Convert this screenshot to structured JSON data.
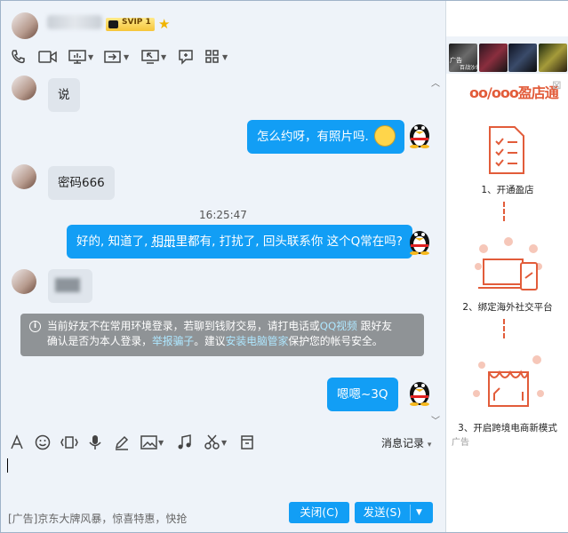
{
  "header": {
    "vip_badge": "SVIP 1",
    "window_controls": [
      "≡",
      "—",
      "☐",
      "✕"
    ]
  },
  "toolbar": {
    "icons": [
      "phone-icon",
      "video-icon",
      "screen-share-icon",
      "transfer-icon",
      "remote-icon",
      "chat-icon",
      "apps-icon"
    ]
  },
  "chat": {
    "messages": [
      {
        "side": "in",
        "text": "说"
      },
      {
        "side": "out",
        "text": "怎么约呀，有照片吗."
      },
      {
        "side": "in",
        "text": "密码666"
      },
      {
        "side": "out",
        "text_parts": [
          "好的, 知道了, ",
          "相册",
          "里都有, 打扰了, 回头联系你 这个Q常在吗?"
        ]
      },
      {
        "side": "in",
        "text": ""
      },
      {
        "side": "out",
        "text": "嗯嗯~3Q"
      }
    ],
    "timestamp": "16:25:47",
    "notice": {
      "line1_a": "当前好友不在常用环境登录，若聊到钱财交易，请打电话或",
      "link_qqvideo": "QQ视频",
      "line1_b": " 跟好友",
      "line2_a": "确认是否为本人登录，",
      "link_report": "举报骗子",
      "line2_b": "。建议",
      "link_guard": "安装电脑管家",
      "line2_c": "保护您的帐号安全。"
    }
  },
  "input": {
    "history_label": "消息记录",
    "history_arrow": "▾"
  },
  "bottom": {
    "ad_text": "[广告]京东大牌风暴，惊喜特惠，快抢",
    "close_label": "关闭(C)",
    "send_label": "发送(S)"
  },
  "sidebar": {
    "game_ad_label": "广告",
    "game_name": "百战沙城",
    "brand": "oo/ooo盈店通",
    "steps": [
      "1、开通盈店",
      "2、绑定海外社交平台",
      "3、开启跨境电商新模式"
    ],
    "ad_tag": "广告",
    "colors": {
      "accent": "#e25c3a"
    }
  },
  "colors": {
    "bubble_out": "#129ef5",
    "bubble_in": "#dfe5ec",
    "button": "#129ef5"
  }
}
